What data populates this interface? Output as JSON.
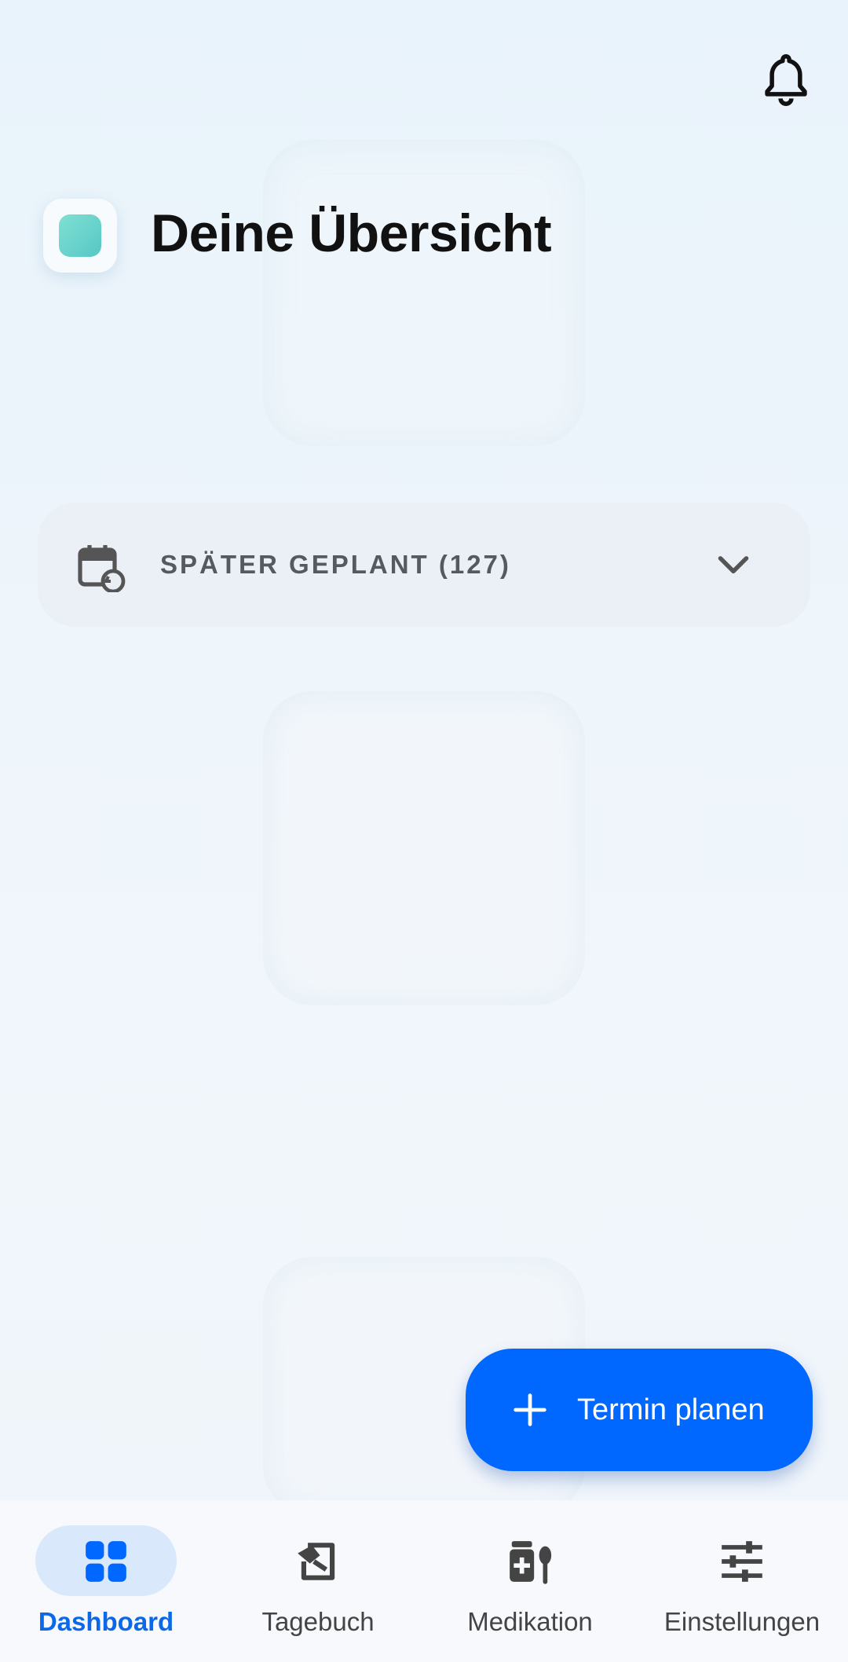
{
  "header": {
    "title": "Deine Übersicht",
    "notification_icon": "bell-icon",
    "logo_icon": "app-logo"
  },
  "planned_section": {
    "label": "SPÄTER GEPLANT (127)",
    "icon": "calendar-history-icon",
    "expand_icon": "chevron-down-icon"
  },
  "fab": {
    "label": "Termin planen",
    "icon": "plus-icon"
  },
  "bottom_nav": {
    "items": [
      {
        "label": "Dashboard",
        "icon": "grid-icon",
        "active": true
      },
      {
        "label": "Tagebuch",
        "icon": "diary-icon",
        "active": false
      },
      {
        "label": "Medikation",
        "icon": "medication-icon",
        "active": false
      },
      {
        "label": "Einstellungen",
        "icon": "sliders-icon",
        "active": false
      }
    ]
  },
  "colors": {
    "accent": "#0067ff",
    "active_nav_text": "#0b68e8",
    "active_nav_pill": "#d9e8fb",
    "title_text": "#111111"
  }
}
